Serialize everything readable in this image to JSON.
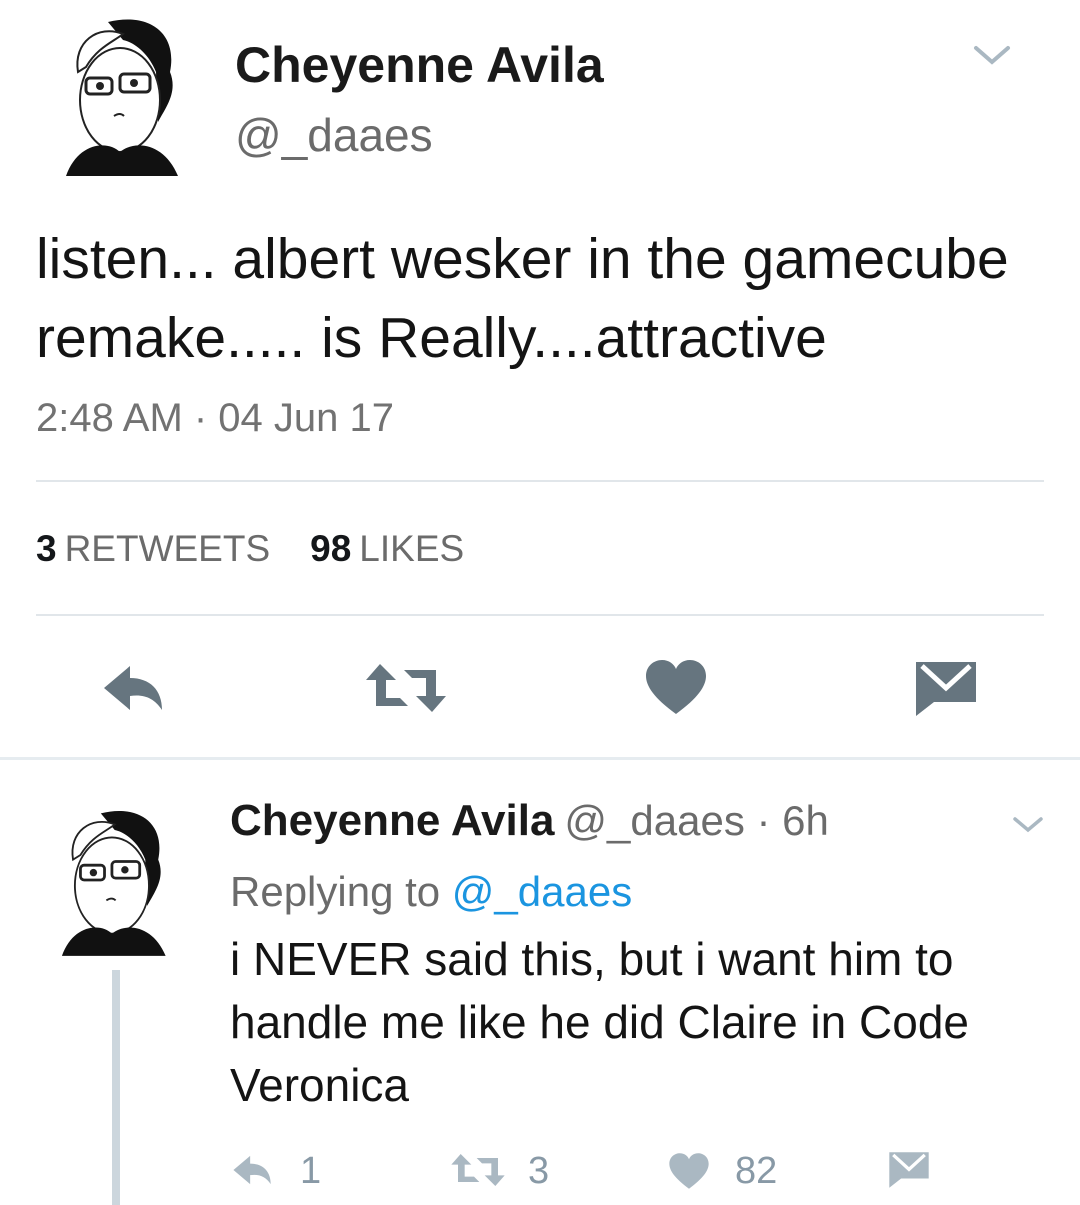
{
  "main_tweet": {
    "author_name": "Cheyenne Avila",
    "author_handle": "@_daaes",
    "text": "listen... albert wesker in the gamecube remake..... is Really....attractive",
    "timestamp": "2:48 AM · 04 Jun 17",
    "retweets_count": "3",
    "retweets_label": "RETWEETS",
    "likes_count": "98",
    "likes_label": "LIKES",
    "actions": [
      "reply-icon",
      "retweet-icon",
      "like-icon",
      "direct-message-icon"
    ]
  },
  "reply_tweet": {
    "author_name": "Cheyenne Avila",
    "meta": "@_daaes · 6h",
    "replying_prefix": "Replying to",
    "replying_handle": "@_daaes",
    "text": "i NEVER said this, but i want him to handle me like he did Claire in Code Veronica",
    "reply_count": "1",
    "retweet_count": "3",
    "like_count": "82"
  },
  "colors": {
    "text": "#14171a",
    "secondary": "#6b6b6b",
    "link": "#1b95e0",
    "icon": "#66757f",
    "icon_light": "#aab8c2"
  }
}
